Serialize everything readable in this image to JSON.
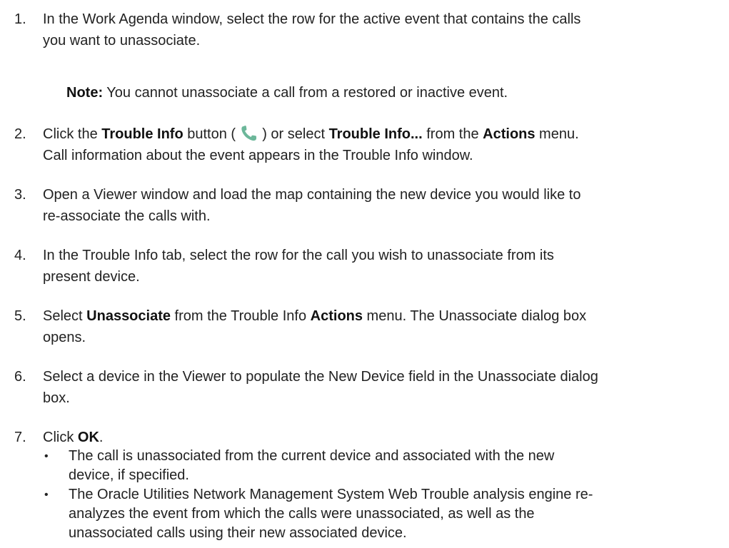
{
  "steps": [
    {
      "num": "1.",
      "lines": [
        "In the Work Agenda window, select the row for the active event that contains the calls",
        "you want to unassociate."
      ]
    },
    {
      "num": "2.",
      "p1": "Click the ",
      "b1": "Trouble Info",
      "p2": " button (",
      "p3": ") or select ",
      "b2": "Trouble Info...",
      "p4": " from the ",
      "b3": "Actions",
      "p5": " menu.",
      "line2": "Call information about the event appears in the Trouble Info window.",
      "icon": "phone-icon",
      "icon_color": "#6cb79a"
    },
    {
      "num": "3.",
      "lines": [
        "Open a Viewer window and load the map containing the new device you would like to",
        "re-associate the calls with."
      ]
    },
    {
      "num": "4.",
      "lines": [
        "In the Trouble Info tab, select the row for the call you wish to unassociate from its",
        "present device."
      ]
    },
    {
      "num": "5.",
      "p1": "Select ",
      "b1": "Unassociate",
      "p2": " from the Trouble Info ",
      "b2": "Actions",
      "p3": " menu. The Unassociate dialog box",
      "line2": "opens."
    },
    {
      "num": "6.",
      "lines": [
        "Select a device in the Viewer to populate the New Device field in the Unassociate dialog",
        "box."
      ]
    },
    {
      "num": "7.",
      "p1": "Click ",
      "b1": "OK",
      "p2": "."
    }
  ],
  "note": {
    "label": "Note:",
    "text": " You cannot unassociate a call from a restored or inactive event."
  },
  "bullets": [
    {
      "symbol": "•",
      "lines": [
        "The call is unassociated from the current device and associated with the new",
        "device, if specified."
      ]
    },
    {
      "symbol": "•",
      "lines": [
        "The Oracle Utilities Network Management System Web Trouble analysis engine re-",
        "analyzes the event from which the calls were unassociated, as well as the",
        "unassociated calls using their new associated device."
      ]
    }
  ]
}
